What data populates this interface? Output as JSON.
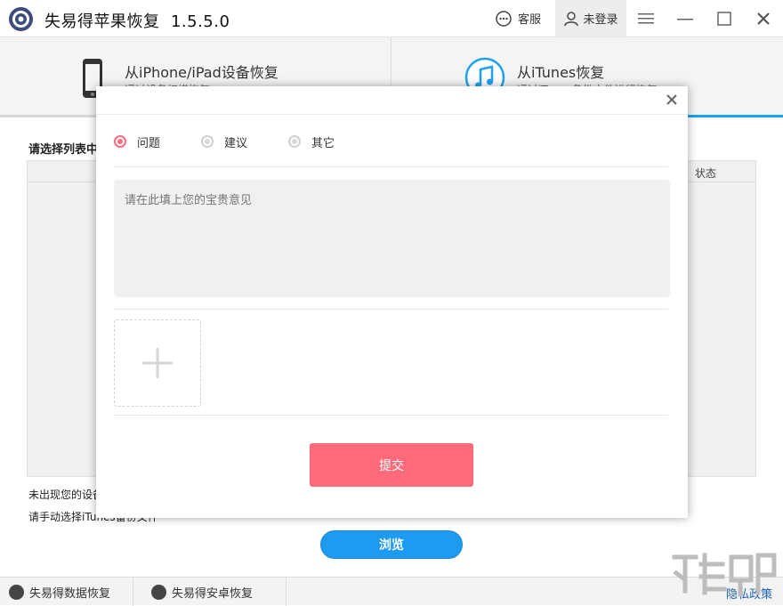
{
  "app": {
    "title": "失易得苹果恢复",
    "version": "1.5.5.0",
    "service_label": "客服",
    "user_label": "未登录"
  },
  "modes": {
    "iphone": {
      "title": "从iPhone/iPad设备恢复",
      "subtitle": "通过设备扫描恢复"
    },
    "itunes": {
      "title": "从iTunes恢复",
      "subtitle": "通过iTunes备份文件进行恢复"
    }
  },
  "main": {
    "list_label": "请选择列表中",
    "status_col": "状态",
    "hint_1": "未出现您的设备",
    "hint_2": "请手动选择iTunes备份文件",
    "browse_label": "浏览"
  },
  "footer": {
    "link_1": "失易得数据恢复",
    "link_2": "失易得安卓恢复",
    "privacy": "隐私政策"
  },
  "modal": {
    "radios": [
      {
        "label": "问题",
        "checked": true
      },
      {
        "label": "建议",
        "checked": false
      },
      {
        "label": "其它",
        "checked": false
      }
    ],
    "placeholder": "请在此填上您的宝贵意见",
    "submit_label": "提交"
  },
  "colors": {
    "accent": "#1d9bf0",
    "submit": "#ff6b7a",
    "logo": "#3d4c7a"
  }
}
